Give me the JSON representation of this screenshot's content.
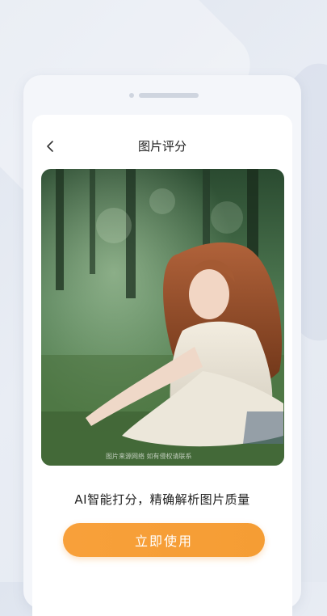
{
  "header": {
    "title": "图片评分"
  },
  "photo": {
    "watermark": "图片来源网络 如有侵权请联系"
  },
  "tagline": "AI智能打分，精确解析图片质量",
  "cta": {
    "label": "立即使用"
  },
  "colors": {
    "accent": "#f7a03a",
    "background": "#e4e9f1"
  },
  "icons": {
    "back": "chevron-left-icon"
  }
}
